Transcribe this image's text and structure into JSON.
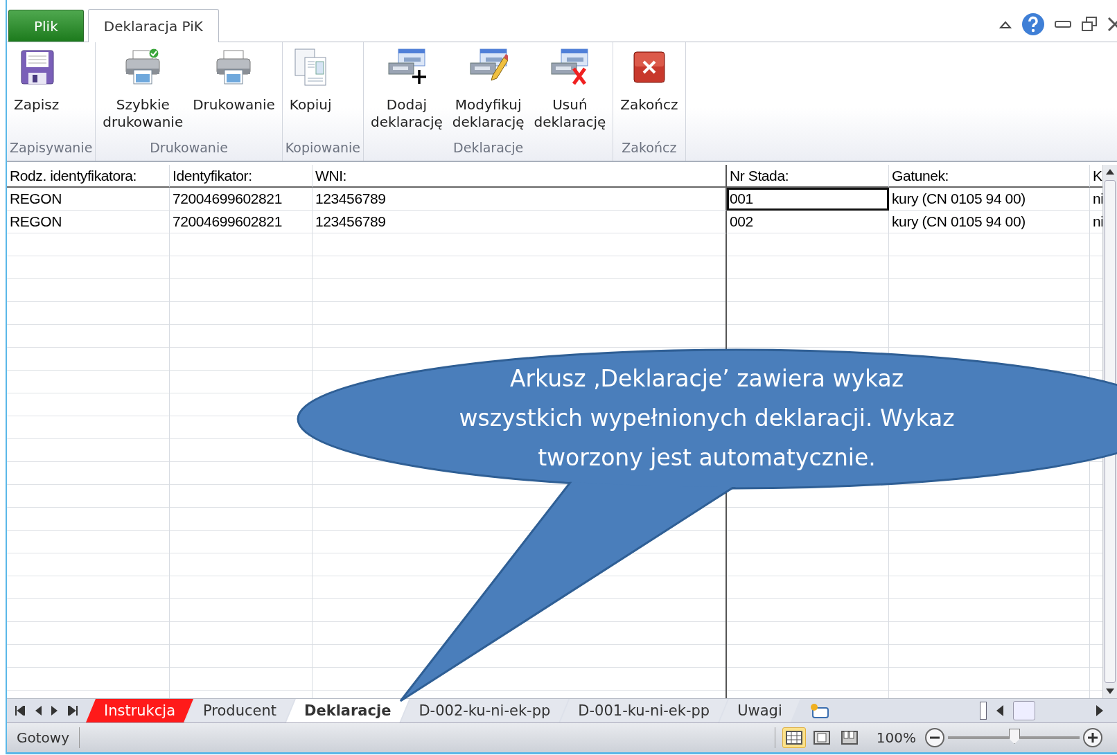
{
  "ribbon": {
    "tabs": [
      {
        "label": "Plik",
        "kind": "file",
        "selected": false
      },
      {
        "label": "Deklaracja PiK",
        "kind": "tab",
        "selected": true
      }
    ],
    "groups": [
      {
        "label": "Zapisywanie",
        "buttons": [
          {
            "label": "Zapisz",
            "kind": "save"
          }
        ]
      },
      {
        "label": "Drukowanie",
        "buttons": [
          {
            "label": "Szybkie\ndrukowanie",
            "kind": "quick-print"
          },
          {
            "label": "Drukowanie",
            "kind": "print"
          }
        ]
      },
      {
        "label": "Kopiowanie",
        "buttons": [
          {
            "label": "Kopiuj",
            "kind": "copy"
          }
        ]
      },
      {
        "label": "Deklaracje",
        "buttons": [
          {
            "label": "Dodaj\ndeklarację",
            "kind": "add"
          },
          {
            "label": "Modyfikuj\ndeklarację",
            "kind": "edit"
          },
          {
            "label": "Usuń\ndeklarację",
            "kind": "delete"
          }
        ]
      },
      {
        "label": "Zakończ",
        "buttons": [
          {
            "label": "Zakończ",
            "kind": "close"
          }
        ]
      }
    ]
  },
  "sheet": {
    "columns": [
      "Rodz. identyfikatora:",
      "Identyfikator:",
      "WNI:",
      "Nr Stada:",
      "Gatunek:",
      "K"
    ],
    "rows": [
      {
        "cells": [
          {
            "text": "REGON",
            "selected": false
          },
          {
            "text": "72004699602821",
            "selected": false
          },
          {
            "text": "123456789",
            "selected": false
          },
          {
            "text": "001",
            "selected": true
          },
          {
            "text": "kury (CN 0105 94 00)",
            "selected": false
          },
          {
            "text": "ni",
            "selected": false
          }
        ]
      },
      {
        "cells": [
          {
            "text": "REGON",
            "selected": false
          },
          {
            "text": "72004699602821",
            "selected": false
          },
          {
            "text": "123456789",
            "selected": false
          },
          {
            "text": "002",
            "selected": false
          },
          {
            "text": "kury (CN 0105 94 00)",
            "selected": false
          },
          {
            "text": "ni",
            "selected": false
          }
        ]
      }
    ]
  },
  "sheet_tabs": [
    {
      "label": "Instrukcja",
      "selected": false,
      "color": "#ff1a1a"
    },
    {
      "label": "Producent",
      "selected": false
    },
    {
      "label": "Deklaracje",
      "selected": true
    },
    {
      "label": "D-002-ku-ni-ek-pp",
      "selected": false
    },
    {
      "label": "D-001-ku-ni-ek-pp",
      "selected": false
    },
    {
      "label": "Uwagi",
      "selected": false
    }
  ],
  "status_bar": {
    "status": "Gotowy",
    "views": [
      {
        "kind": "normal",
        "selected": true
      },
      {
        "kind": "page-layout",
        "selected": false
      },
      {
        "kind": "page-break",
        "selected": false
      }
    ],
    "zoom": "100%",
    "zoom_slider": {
      "level": 0.5
    }
  },
  "callout": {
    "text": "Arkusz ‚Deklaracje’ zawiera wykaz\nwszystkich wypełnionych deklaracji. Wykaz\ntworzony jest automatycznie."
  }
}
